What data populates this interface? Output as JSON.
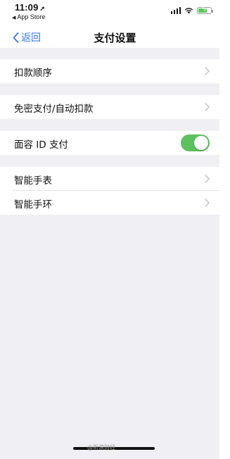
{
  "status_bar": {
    "time": "11:09",
    "location_icon": "➚",
    "back_app_label": "App Store",
    "back_triangle": "◀",
    "battery_color": "#5ac85a"
  },
  "nav": {
    "back_label": "返回",
    "title": "支付设置",
    "accent_color": "#3478f6"
  },
  "settings": {
    "row_payment_order": "扣款顺序",
    "row_password_free": "免密支付/自动扣款",
    "row_face_id": "面容 ID 支付",
    "face_id_enabled": true,
    "row_smart_watch": "智能手表",
    "row_smart_band": "智能手环",
    "toggle_color": "#5ec15f"
  },
  "watermark": "@新浪财经"
}
